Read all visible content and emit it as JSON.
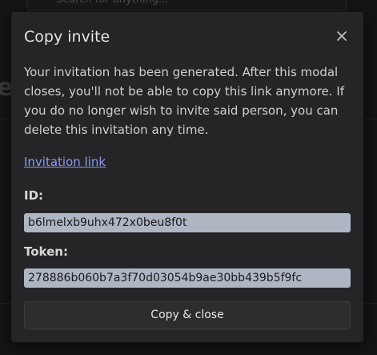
{
  "background": {
    "search_placeholder": "Search for anything..."
  },
  "modal": {
    "title": "Copy invite",
    "description": "Your invitation has been generated. After this modal closes, you'll not be able to copy this link anymore. If you do no longer wish to invite said person, you can delete this invitation any time.",
    "invitation_link": "Invitation link",
    "id_label": "ID:",
    "id_value": "b6lmelxb9uhx472x0beu8f0t",
    "token_label": "Token:",
    "token_value": "278886b060b7a3f70d03054b9ae30bb439b5f9fc",
    "copy_close_label": "Copy & close"
  },
  "colors": {
    "link": "#8a9bf5",
    "field_bg": "#aeb5c3",
    "modal_bg": "#252528"
  },
  "icons": {
    "close": "close-icon"
  }
}
